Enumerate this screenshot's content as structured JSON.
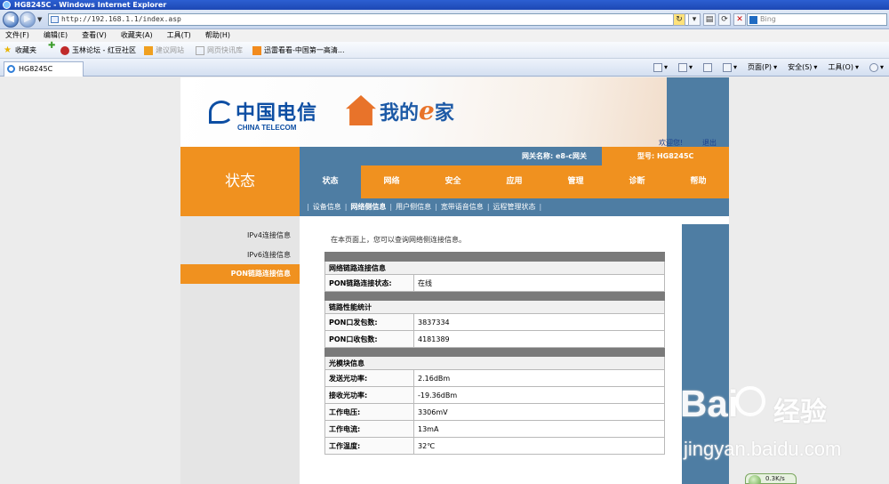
{
  "window": {
    "title": "HG8245C - Windows Internet Explorer"
  },
  "addressbar": {
    "url": "http://192.168.1.1/index.asp",
    "search_placeholder": "Bing"
  },
  "menubar": [
    "文件(F)",
    "编辑(E)",
    "查看(V)",
    "收藏夹(A)",
    "工具(T)",
    "帮助(H)"
  ],
  "favorites": {
    "favorites_label": "收藏夹",
    "items": [
      "玉林论坛 - 红豆社区",
      "建议网站",
      "网页快讯库",
      "迅雷看看-中国第一高清..."
    ]
  },
  "tab": {
    "label": "HG8245C"
  },
  "commandbar": {
    "page": "页面(P)",
    "safety": "安全(S)",
    "tools": "工具(O)"
  },
  "header": {
    "brand_cn": "中国电信",
    "brand_en": "CHINA TELECOM",
    "ehome_pre": "我的",
    "ehome_e": "e",
    "ehome_post": "家",
    "welcome": "欢迎您!",
    "logout": "退出"
  },
  "topinfo": {
    "gateway_name": "网关名称: e8-c网关",
    "model": "型号: HG8245C"
  },
  "section_title": "状态",
  "mainnav": [
    "状态",
    "网络",
    "安全",
    "应用",
    "管理",
    "诊断",
    "帮助"
  ],
  "subnav": [
    "设备信息",
    "网络侧信息",
    "用户侧信息",
    "宽带语音信息",
    "远程管理状态"
  ],
  "leftmenu": [
    "IPv4连接信息",
    "IPv6连接信息",
    "PON链路连接信息"
  ],
  "intro": "在本页面上，您可以查询网络侧连接信息。",
  "table": {
    "sec1_title": "网络链路连接信息",
    "sec1_rows": [
      {
        "label": "PON链路连接状态:",
        "value": "在线"
      }
    ],
    "sec2_title": "链路性能统计",
    "sec2_rows": [
      {
        "label": "PON口发包数:",
        "value": "3837334"
      },
      {
        "label": "PON口收包数:",
        "value": "4181389"
      }
    ],
    "sec3_title": "光模块信息",
    "sec3_rows": [
      {
        "label": "发送光功率:",
        "value": "2.16dBm"
      },
      {
        "label": "接收光功率:",
        "value": "-19.36dBm"
      },
      {
        "label": "工作电压:",
        "value": "3306mV"
      },
      {
        "label": "工作电流:",
        "value": "13mA"
      },
      {
        "label": "工作温度:",
        "value": "32℃"
      }
    ]
  },
  "watermark": {
    "bai": "Bai",
    "cn": "经验",
    "url": "jingyan.baidu.com"
  },
  "netspeed": "0.3K/s"
}
